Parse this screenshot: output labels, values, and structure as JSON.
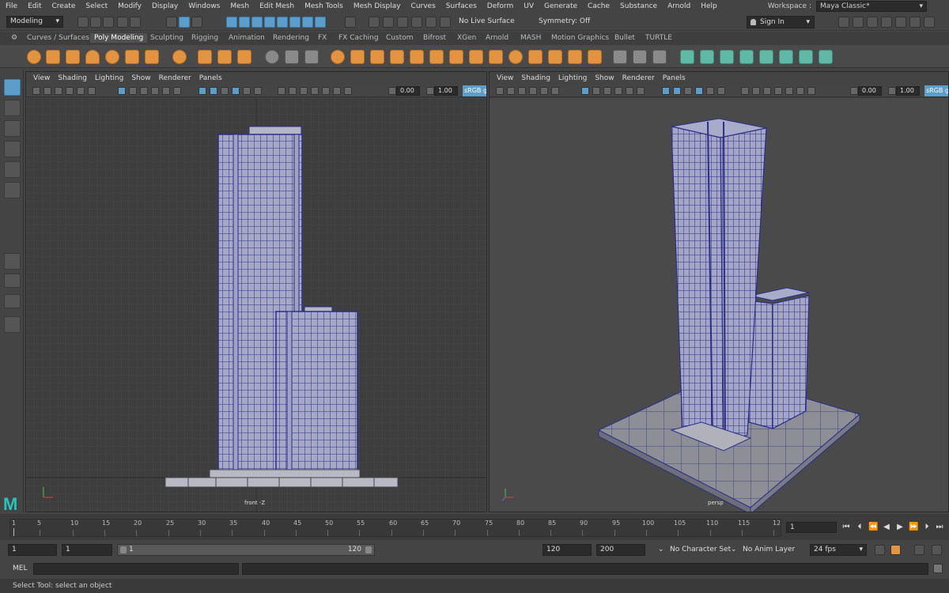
{
  "menubar": {
    "items": [
      "File",
      "Edit",
      "Create",
      "Select",
      "Modify",
      "Display",
      "Windows",
      "Mesh",
      "Edit Mesh",
      "Mesh Tools",
      "Mesh Display",
      "Curves",
      "Surfaces",
      "Deform",
      "UV",
      "Generate",
      "Cache",
      "Substance",
      "Arnold",
      "Help"
    ],
    "workspace_label": "Workspace :",
    "workspace_value": "Maya Classic*"
  },
  "statusline": {
    "menuset": "Modeling",
    "live_surface": "No Live Surface",
    "symmetry": "Symmetry: Off",
    "sign_in": "Sign In"
  },
  "shelf": {
    "tabs": [
      "Curves / Surfaces",
      "Poly Modeling",
      "Sculpting",
      "Rigging",
      "Animation",
      "Rendering",
      "FX",
      "FX Caching",
      "Custom",
      "Bifrost",
      "XGen",
      "Arnold",
      "MASH",
      "Motion Graphics",
      "Bullet",
      "TURTLE"
    ],
    "active_tab": "Poly Modeling"
  },
  "viewport_left": {
    "menus": [
      "View",
      "Shading",
      "Lighting",
      "Show",
      "Renderer",
      "Panels"
    ],
    "exposure": "0.00",
    "gamma": "1.00",
    "color_space": "sRGB g",
    "camera": "front -Z"
  },
  "viewport_right": {
    "menus": [
      "View",
      "Shading",
      "Lighting",
      "Show",
      "Renderer",
      "Panels"
    ],
    "exposure": "0.00",
    "gamma": "1.00",
    "color_space": "sRGB g",
    "camera": "persp"
  },
  "timeslider": {
    "ticks": [
      "1",
      "5",
      "10",
      "15",
      "20",
      "25",
      "30",
      "35",
      "40",
      "45",
      "50",
      "55",
      "60",
      "65",
      "70",
      "75",
      "80",
      "85",
      "90",
      "95",
      "100",
      "105",
      "110",
      "115",
      "12"
    ],
    "current_frame": "1"
  },
  "range": {
    "start": "1",
    "anim_start": "1",
    "range_start_label": "1",
    "range_end_label": "120",
    "playback_end": "120",
    "anim_end": "200",
    "character_set": "No Character Set",
    "anim_layer": "No Anim Layer",
    "fps": "24 fps"
  },
  "cmdline": {
    "label": "MEL"
  },
  "helpline": {
    "text": "Select Tool: select an object"
  }
}
